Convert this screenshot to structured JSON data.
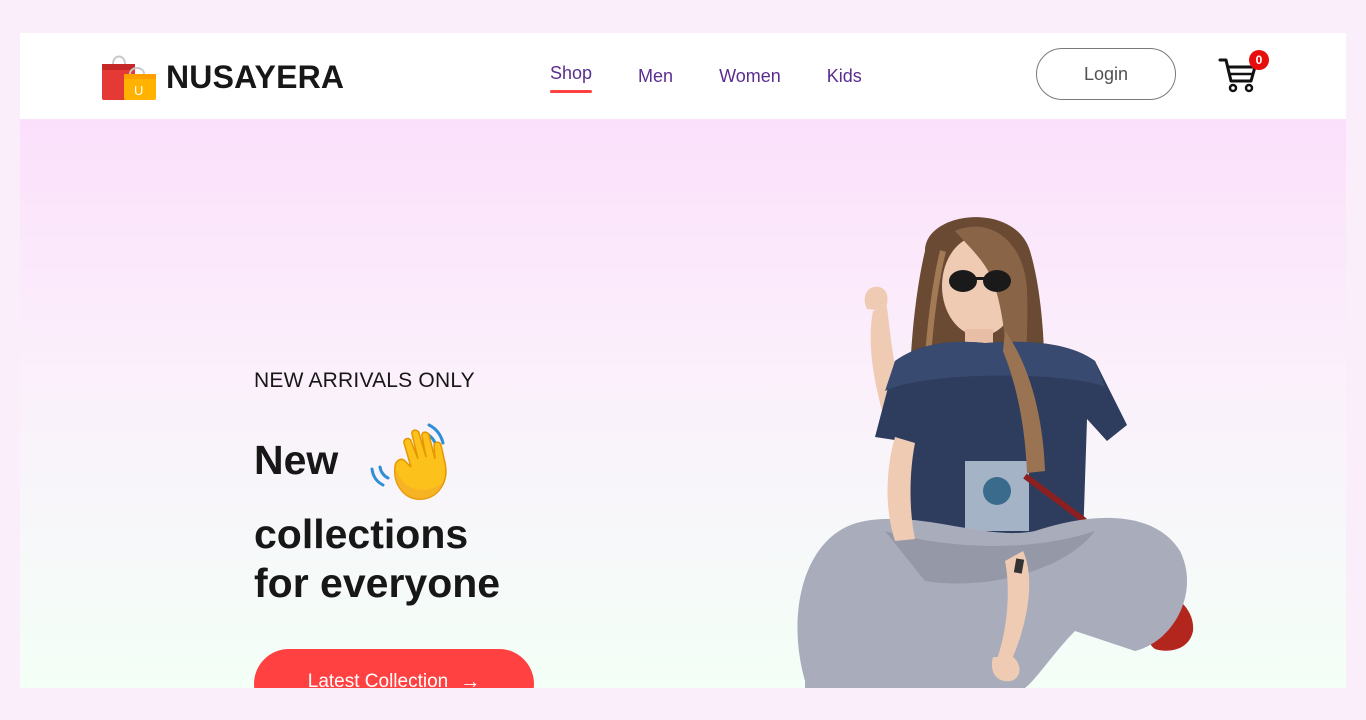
{
  "brand": {
    "name": "NUSAYERA",
    "bag_letter": "U"
  },
  "nav": {
    "items": [
      {
        "label": "Shop",
        "active": true
      },
      {
        "label": "Men",
        "active": false
      },
      {
        "label": "Women",
        "active": false
      },
      {
        "label": "Kids",
        "active": false
      }
    ]
  },
  "header": {
    "login_label": "Login",
    "cart_count": "0"
  },
  "hero": {
    "tag": "NEW ARRIVALS ONLY",
    "line1": "New",
    "line2": "collections",
    "line3": "for everyone",
    "cta_label": "Latest Collection",
    "cta_arrow": "→"
  },
  "colors": {
    "accent": "#ff4141",
    "nav_text": "#5a2d8f",
    "text": "#171717",
    "hero_top": "#fbe0fb",
    "hero_bottom": "#f3fff7",
    "page_bg": "#fbeefb"
  },
  "icons": {
    "logo": "shopping-bags-icon",
    "cart": "cart-icon",
    "wave": "waving-hand-icon",
    "arrow": "arrow-right-icon"
  }
}
